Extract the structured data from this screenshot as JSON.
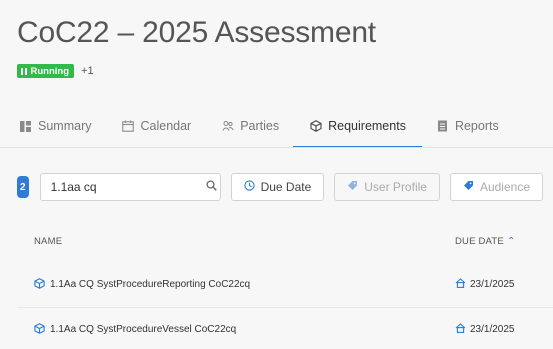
{
  "assessment": {
    "title": "CoC22 – 2025 Assessment",
    "status_label": "Running",
    "extra_badge_count": "+1"
  },
  "tabs": [
    {
      "label": "Summary",
      "icon": "summary-icon"
    },
    {
      "label": "Calendar",
      "icon": "calendar-icon"
    },
    {
      "label": "Parties",
      "icon": "parties-icon"
    },
    {
      "label": "Requirements",
      "icon": "requirements-icon",
      "active": true
    },
    {
      "label": "Reports",
      "icon": "reports-icon"
    }
  ],
  "filters": {
    "count": "2",
    "search_value": "1.1aa cq",
    "due_date_label": "Due Date",
    "user_profile_label": "User Profile",
    "audience_label": "Audience"
  },
  "table": {
    "columns": {
      "name": "NAME",
      "due_date": "DUE DATE"
    },
    "rows": [
      {
        "name": "1.1Aa CQ SystProcedureReporting CoC22cq",
        "due_date": "23/1/2025"
      },
      {
        "name": "1.1Aa CQ SystProcedureVessel CoC22cq",
        "due_date": "23/1/2025"
      }
    ]
  },
  "colors": {
    "accent": "#2e7bd6",
    "running": "#33b84a"
  }
}
